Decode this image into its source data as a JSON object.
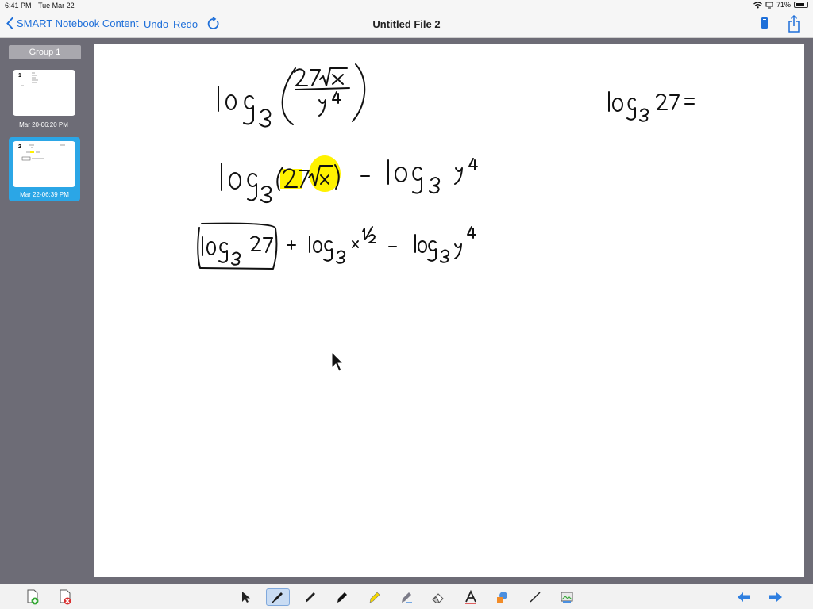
{
  "status": {
    "time": "6:41 PM",
    "date": "Tue Mar 22",
    "battery": "71%",
    "battery_level": 0.71
  },
  "nav": {
    "back_label": "SMART Notebook Content",
    "undo_label": "Undo",
    "redo_label": "Redo",
    "title": "Untitled File 2"
  },
  "sidebar": {
    "group_label": "Group 1",
    "pages": [
      {
        "number": "1",
        "caption": "Mar 20-06:20 PM",
        "selected": false
      },
      {
        "number": "2",
        "caption": "Mar 22-06:39 PM",
        "selected": true
      }
    ]
  },
  "canvas": {
    "ink": {
      "line1": {
        "log": "log",
        "base": "3",
        "numerator": "27√x",
        "denominator": "y⁴"
      },
      "line2": {
        "log": "log",
        "base": "3",
        "arg": "27√x",
        "minus": "−",
        "log2": "log",
        "base2": "3",
        "term": "y⁴"
      },
      "line3": {
        "boxed": "log₃27",
        "plus": "+",
        "log": "log",
        "base": "3",
        "term": "x½",
        "minus": "−",
        "log2": "log",
        "base2": "3",
        "term2": "y⁴"
      },
      "side": {
        "log": "log",
        "base": "3",
        "arg": "27",
        "eq": "="
      }
    },
    "highlight_color": "#fff200",
    "ink_color": "#111111"
  },
  "toolbar": {
    "left_tools": [
      "add-page-icon",
      "delete-page-icon"
    ],
    "tools": [
      "select-icon",
      "pen-icon",
      "calligraphy-pen-icon",
      "marker-icon",
      "highlighter-icon",
      "magic-pen-icon",
      "eraser-icon",
      "text-icon",
      "fill-icon",
      "line-icon",
      "gallery-icon"
    ],
    "selected_tool": "pen-icon",
    "nav_tools": [
      "previous-page-icon",
      "next-page-icon"
    ],
    "accent": "#1e6fd9"
  }
}
